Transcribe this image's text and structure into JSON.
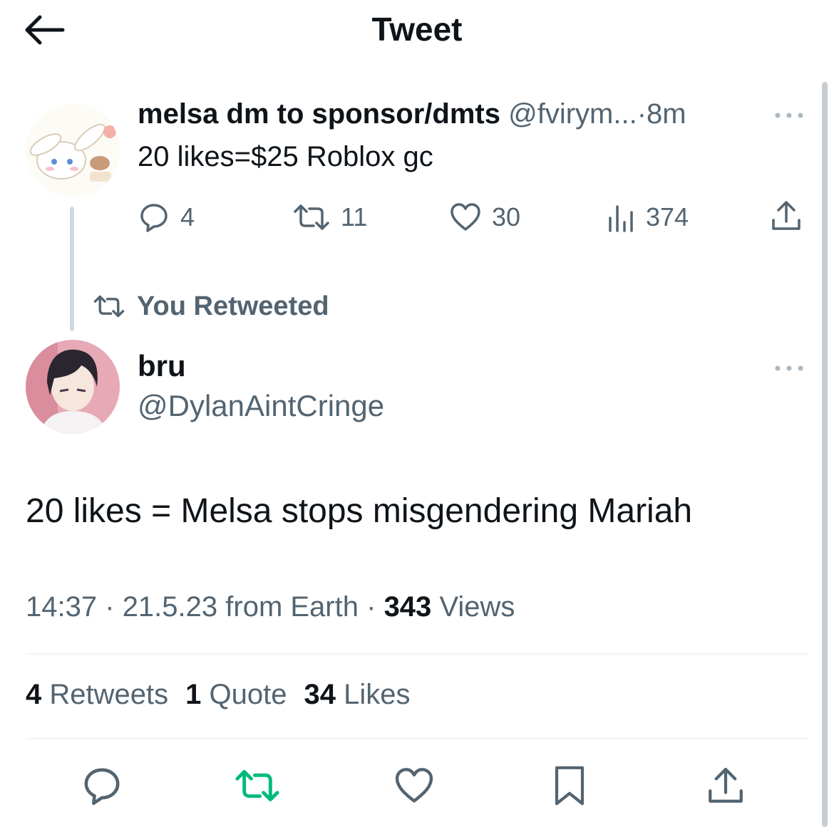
{
  "header": {
    "title": "Tweet",
    "back_icon": "arrow-left-icon"
  },
  "quoted_tweet": {
    "author_name": "melsa dm to sponsor/dmts",
    "author_handle": "@fvirym...",
    "separator": "·",
    "time": "8m",
    "text": "20 likes=$25 Roblox gc",
    "replies": "4",
    "retweets": "11",
    "likes": "30",
    "views": "374",
    "avatar_icon": "cinnamoroll-avatar"
  },
  "retweet_banner": {
    "label": "You Retweeted",
    "icon": "retweet-icon"
  },
  "main_tweet": {
    "author_name": "bru",
    "author_handle": "@DylanAintCringe",
    "text": "20 likes = Melsa stops misgendering Mariah",
    "time": "14:37",
    "date": "21.5.23 from Earth",
    "views_count": "343",
    "views_label": "Views",
    "sep": "·",
    "avatar_icon": "anime-avatar"
  },
  "stats": {
    "retweets_count": "4",
    "retweets_label": "Retweets",
    "quotes_count": "1",
    "quotes_label": "Quote",
    "likes_count": "34",
    "likes_label": "Likes"
  },
  "colors": {
    "text": "#0f1419",
    "secondary": "#536471",
    "retweet_active": "#00ba7c",
    "divider": "#eff3f4"
  }
}
